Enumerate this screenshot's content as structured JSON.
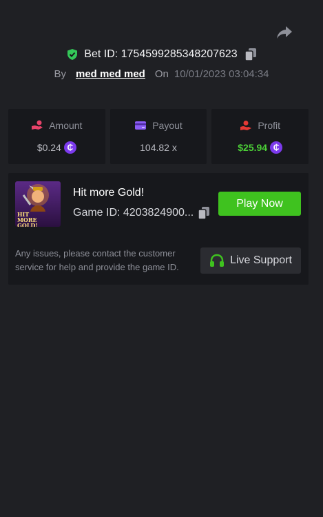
{
  "header": {
    "bet_id_label": "Bet ID: 1754599285348207623",
    "by_label": "By",
    "username": "med med med",
    "on_label": "On",
    "timestamp": "10/01/2023 03:04:34"
  },
  "stats": {
    "amount": {
      "label": "Amount",
      "value": "$0.24",
      "coin_symbol": "₵"
    },
    "payout": {
      "label": "Payout",
      "value": "104.82 x"
    },
    "profit": {
      "label": "Profit",
      "value": "$25.94",
      "coin_symbol": "₵"
    }
  },
  "game": {
    "title": "Hit more Gold!",
    "game_id_label": "Game ID: 4203824900...",
    "thumbnail_text": "HIT MORE GOLD!",
    "play_label": "Play Now"
  },
  "support": {
    "text": "Any issues, please contact the customer service for help and provide the game ID.",
    "button_label": "Live Support"
  },
  "colors": {
    "background": "#1f2024",
    "card": "#17181c",
    "accent_green": "#3fc21f",
    "profit_green": "#4cd137",
    "coin_purple": "#7c3aed",
    "amount_icon": "#e8436a",
    "payout_icon": "#8b5cf6",
    "profit_icon": "#e53935"
  },
  "icons": {
    "share": "share-arrow-icon",
    "verified": "shield-check-icon",
    "copy": "copy-icon",
    "amount": "hand-coin-icon",
    "payout": "card-icon",
    "profit": "hand-money-icon",
    "support": "headphones-icon"
  }
}
